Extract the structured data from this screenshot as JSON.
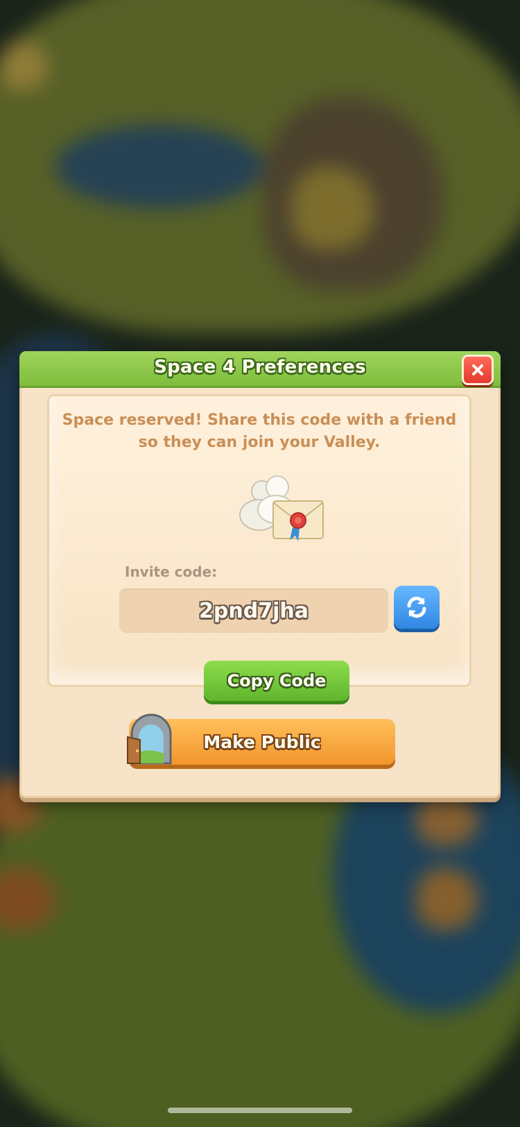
{
  "dialog": {
    "title": "Space 4 Preferences",
    "message": "Space reserved! Share this code with a friend so they can join your Valley.",
    "invite_label": "Invite code:",
    "invite_code": "2pnd7jha",
    "copy_label": "Copy Code",
    "public_label": "Make Public"
  },
  "icons": {
    "close": "close-icon",
    "refresh": "refresh-icon",
    "illustration": "friends-invite-envelope-icon",
    "door": "door-icon"
  },
  "colors": {
    "header_green": "#7fbd3d",
    "panel_cream": "#f6e3c8",
    "close_red": "#e23a2e",
    "refresh_blue": "#2f86e2",
    "copy_green": "#5fb52d",
    "public_orange": "#f3962d",
    "message_text": "#c98f57"
  }
}
